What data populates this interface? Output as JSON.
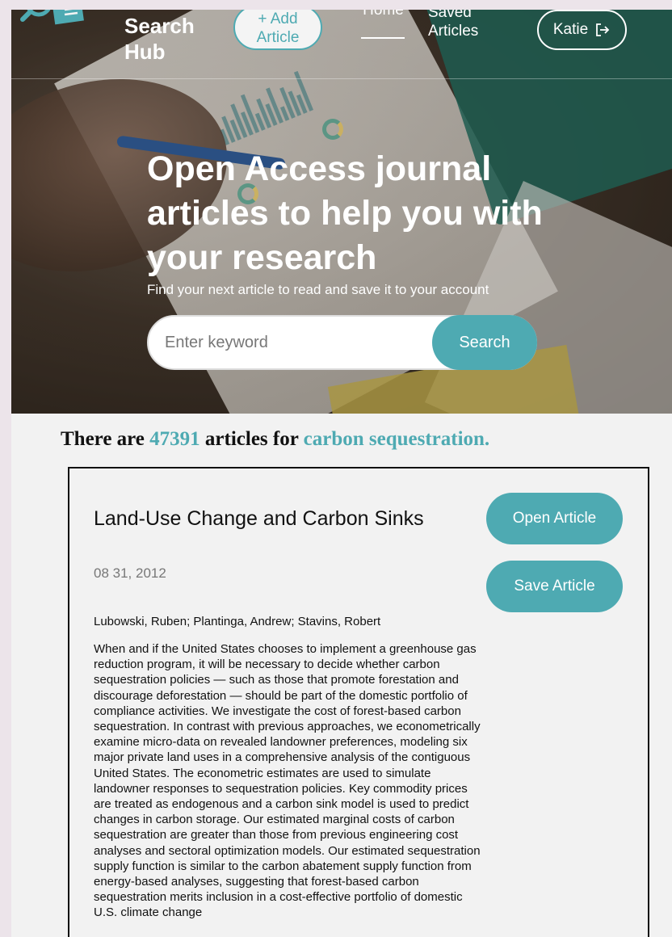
{
  "nav": {
    "brand": "Search Hub",
    "add_article": "+ Add Article",
    "home": "Home",
    "saved_articles": "Saved Articles",
    "user": "Katie"
  },
  "hero": {
    "headline": "Open Access journal articles to help you with your research",
    "subline": "Find your next article to read and save it to your account",
    "search_placeholder": "Enter keyword",
    "search_button": "Search"
  },
  "results": {
    "prefix": "There are",
    "count": "47391",
    "middle": "articles for",
    "query": "carbon sequestration."
  },
  "article": {
    "title": "Land-Use Change and Carbon Sinks",
    "date": "08 31, 2012",
    "authors": "Lubowski, Ruben; Plantinga, Andrew; Stavins, Robert",
    "abstract": "When and if the United States chooses to implement a greenhouse gas reduction program, it will be necessary to decide whether carbon sequestration policies — such as those that promote forestation and discourage deforestation — should be part of the domestic portfolio of compliance activities. We investigate the cost of forest-based carbon sequestration. In contrast with previous approaches, we econometrically examine micro-data on revealed landowner preferences, modeling six major private land uses in a comprehensive analysis of the contiguous United States. The econometric estimates are used to simulate landowner responses to sequestration policies. Key commodity prices are treated as endogenous and a carbon sink model is used to predict changes in carbon storage. Our estimated marginal costs of carbon sequestration are greater than those from previous engineering cost analyses and sectoral optimization models. Our estimated sequestration supply function is similar to the carbon abatement supply function from energy-based analyses, suggesting that forest-based carbon sequestration merits inclusion in a cost-effective portfolio of domestic U.S. climate change",
    "open_button": "Open Article",
    "save_button": "Save Article"
  },
  "colors": {
    "accent": "#4eaab2",
    "text": "#111111",
    "muted": "#777777",
    "card_bg": "#f2f2f2"
  }
}
